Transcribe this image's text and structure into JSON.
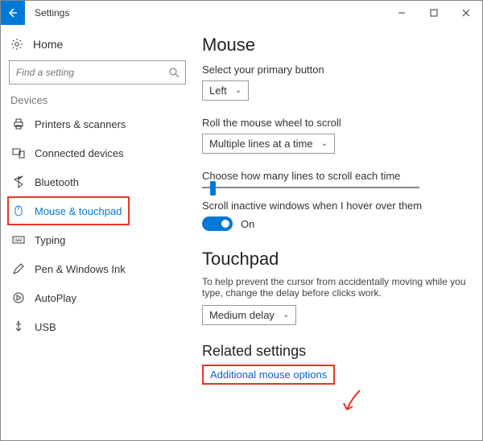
{
  "window": {
    "title": "Settings"
  },
  "sidebar": {
    "home": "Home",
    "search_placeholder": "Find a setting",
    "group": "Devices",
    "items": [
      {
        "label": "Printers & scanners"
      },
      {
        "label": "Connected devices"
      },
      {
        "label": "Bluetooth"
      },
      {
        "label": "Mouse & touchpad"
      },
      {
        "label": "Typing"
      },
      {
        "label": "Pen & Windows Ink"
      },
      {
        "label": "AutoPlay"
      },
      {
        "label": "USB"
      }
    ]
  },
  "main": {
    "mouse_heading": "Mouse",
    "primary_label": "Select your primary button",
    "primary_value": "Left",
    "wheel_label": "Roll the mouse wheel to scroll",
    "wheel_value": "Multiple lines at a time",
    "lines_label": "Choose how many lines to scroll each time",
    "inactive_label": "Scroll inactive windows when I hover over them",
    "inactive_state": "On",
    "touchpad_heading": "Touchpad",
    "touchpad_help": "To help prevent the cursor from accidentally moving while you type, change the delay before clicks work.",
    "delay_value": "Medium delay",
    "related_heading": "Related settings",
    "related_link": "Additional mouse options"
  }
}
